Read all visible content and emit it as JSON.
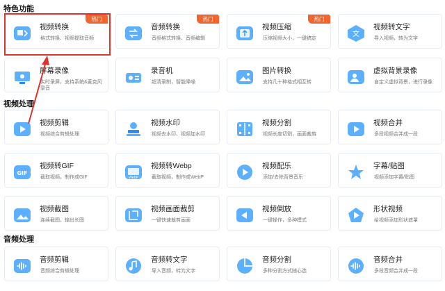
{
  "sections": [
    {
      "title": "特色功能"
    },
    {
      "title": "视频处理"
    },
    {
      "title": "音频处理"
    }
  ],
  "hot_label": "热门",
  "cards": [
    {
      "title": "视频转换",
      "desc": "格式转换、视频提取音频",
      "icon": "video-convert-icon",
      "hot": true
    },
    {
      "title": "音频转换",
      "desc": "音频格式转换、音频编辑",
      "icon": "audio-convert-icon",
      "hot": true
    },
    {
      "title": "视频压缩",
      "desc": "压缩视频大小，一键搞定",
      "icon": "video-compress-icon",
      "hot": true
    },
    {
      "title": "视频转文字",
      "desc": "导入视频，转为文字",
      "icon": "video-to-text-icon",
      "hot": false
    },
    {
      "title": "屏幕录像",
      "desc": "实时录屏，支持系统&麦克风录音",
      "icon": "screen-record-icon",
      "hot": false
    },
    {
      "title": "录音机",
      "desc": "超清录制，智能降噪",
      "icon": "recorder-icon",
      "hot": false
    },
    {
      "title": "图片转换",
      "desc": "支持几十种格式相互转",
      "icon": "image-convert-icon",
      "hot": false
    },
    {
      "title": "虚拟背景录像",
      "desc": "自定义虚拟背景，进行录像",
      "icon": "virtual-bg-icon",
      "hot": false
    },
    {
      "title": "视频剪辑",
      "desc": "视频综合剪辑处理",
      "icon": "video-edit-icon",
      "hot": false
    },
    {
      "title": "视频水印",
      "desc": "视频去水印、视频加水印",
      "icon": "video-watermark-icon",
      "hot": false
    },
    {
      "title": "视频分割",
      "desc": "视频长度切割，画面裁剪",
      "icon": "video-split-icon",
      "hot": false
    },
    {
      "title": "视频合并",
      "desc": "多段视频合并成一段",
      "icon": "video-merge-icon",
      "hot": false
    },
    {
      "title": "视频转GIF",
      "desc": "截取视频，制作成GIF",
      "icon": "gif-icon",
      "hot": false
    },
    {
      "title": "视频转Webp",
      "desc": "截取视频，制作成WebP",
      "icon": "webp-icon",
      "hot": false
    },
    {
      "title": "视频配乐",
      "desc": "添加/去除背景音乐",
      "icon": "video-music-icon",
      "hot": false
    },
    {
      "title": "字幕/贴图",
      "desc": "视频添加字幕/贴图",
      "icon": "subtitle-sticker-icon",
      "hot": false
    },
    {
      "title": "视频截图",
      "desc": "连续截图，输出长图",
      "icon": "video-screenshot-icon",
      "hot": false
    },
    {
      "title": "视频画面裁剪",
      "desc": "一键快速裁剪画面",
      "icon": "video-crop-icon",
      "hot": false
    },
    {
      "title": "视频倒放",
      "desc": "一键操作，多种模式",
      "icon": "video-reverse-icon",
      "hot": false
    },
    {
      "title": "形状视频",
      "desc": "给视频添加形状遮罩",
      "icon": "shape-video-icon",
      "hot": false
    },
    {
      "title": "音频剪辑",
      "desc": "音频综合剪辑处理",
      "icon": "audio-edit-icon",
      "hot": false
    },
    {
      "title": "音频转文字",
      "desc": "导入音频，转为文字",
      "icon": "audio-to-text-icon",
      "hot": false
    },
    {
      "title": "音频分割",
      "desc": "多种分割方式随心选",
      "icon": "audio-split-icon",
      "hot": false
    },
    {
      "title": "音频合并",
      "desc": "多段音频合并成一段",
      "icon": "audio-merge-icon",
      "hot": false
    }
  ],
  "colors": {
    "accent": "#2f8cf0",
    "accent_light": "#5cb0ff",
    "hot_badge": "#f2652d",
    "highlight": "#e0332b"
  }
}
